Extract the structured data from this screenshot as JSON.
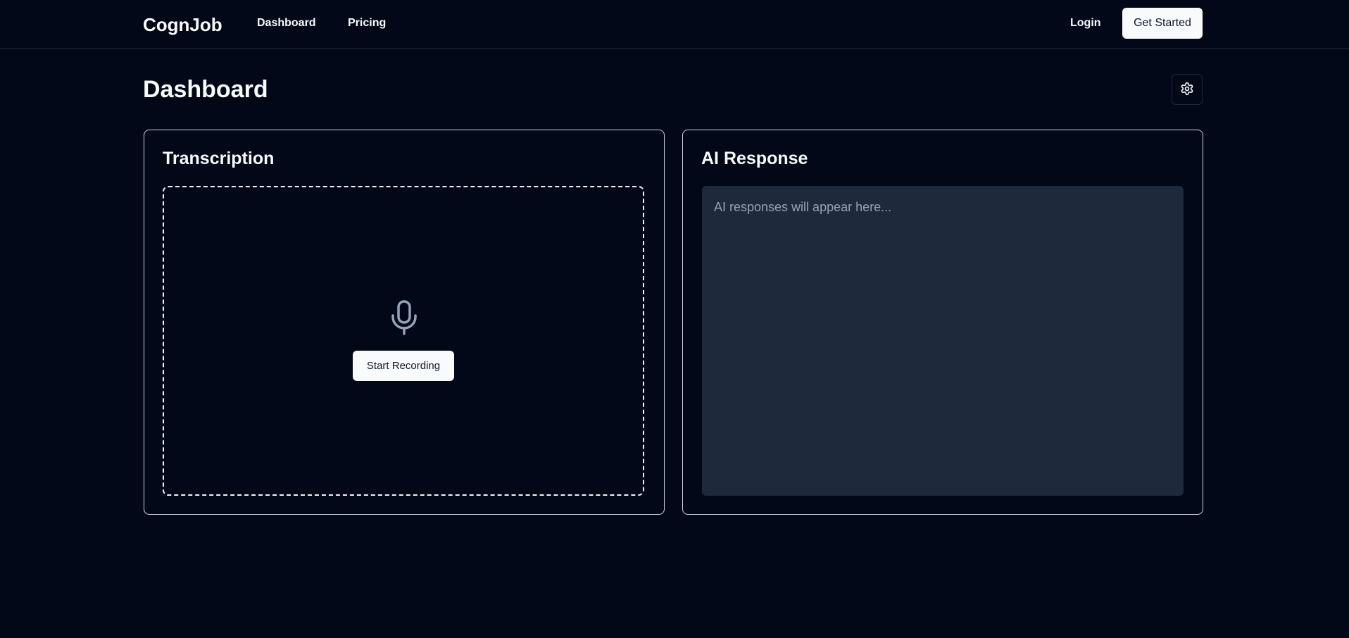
{
  "nav": {
    "brand": "CognJob",
    "links": [
      "Dashboard",
      "Pricing"
    ],
    "login": "Login",
    "get_started": "Get Started"
  },
  "page": {
    "title": "Dashboard"
  },
  "transcription": {
    "title": "Transcription",
    "button": "Start Recording"
  },
  "ai": {
    "title": "AI Response",
    "placeholder": "AI responses will appear here..."
  },
  "icons": {
    "settings": "gear-icon",
    "mic": "microphone-icon"
  },
  "colors": {
    "background": "#020817",
    "surface": "#1e293b",
    "primary_button": "#f8fafc",
    "muted_text": "#94a3b8"
  }
}
